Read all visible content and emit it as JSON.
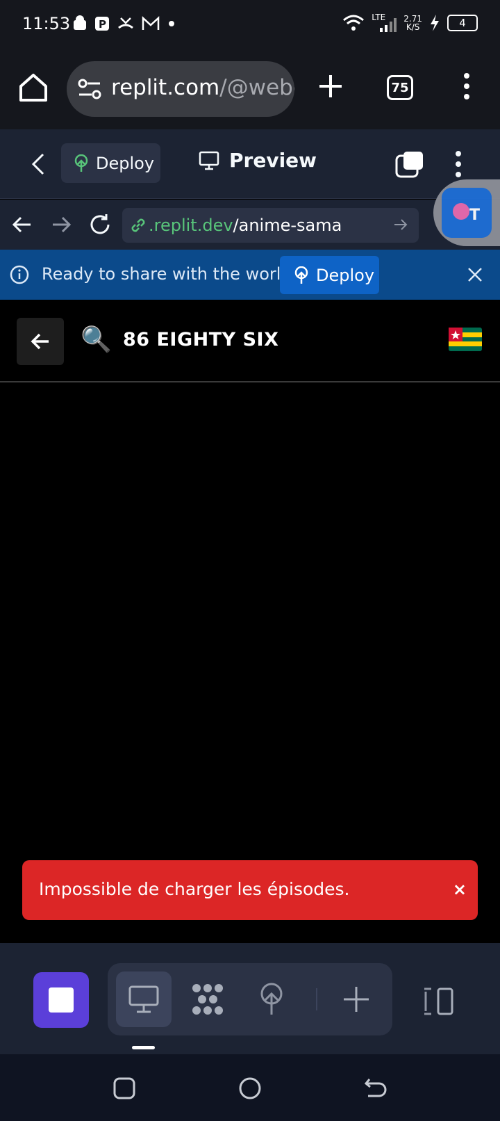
{
  "status_bar": {
    "time": "11:53",
    "network_type": "LTE",
    "net_speed_value": "2.71",
    "net_speed_unit": "K/S",
    "battery": "4"
  },
  "browser": {
    "url_host": "replit.com",
    "url_path": "/@webé",
    "tab_count": "75",
    "icons": [
      "home-icon",
      "site-settings-icon",
      "new-tab-icon",
      "tab-switcher-icon",
      "overflow-menu-icon"
    ]
  },
  "replit_header": {
    "deploy_label": "Deploy",
    "preview_label": "Preview"
  },
  "replit_nav": {
    "url_domain": ".replit.dev",
    "url_path": "/anime-sama"
  },
  "banner": {
    "message": "Ready to share with the world?",
    "deploy_label": "Deploy"
  },
  "app": {
    "search_emoji": "🔍",
    "title": "86 EIGHTY SIX",
    "flag": "togo-flag"
  },
  "toast": {
    "message": "Impossible de charger les épisodes.",
    "close_label": "×"
  },
  "colors": {
    "replit_bg": "#1c2333",
    "banner_bg": "#0b4a8b",
    "accent_blue": "#0e63c6",
    "stop_purple": "#5b3fd9",
    "error_red": "#dc2626",
    "link_green": "#58c47a"
  }
}
